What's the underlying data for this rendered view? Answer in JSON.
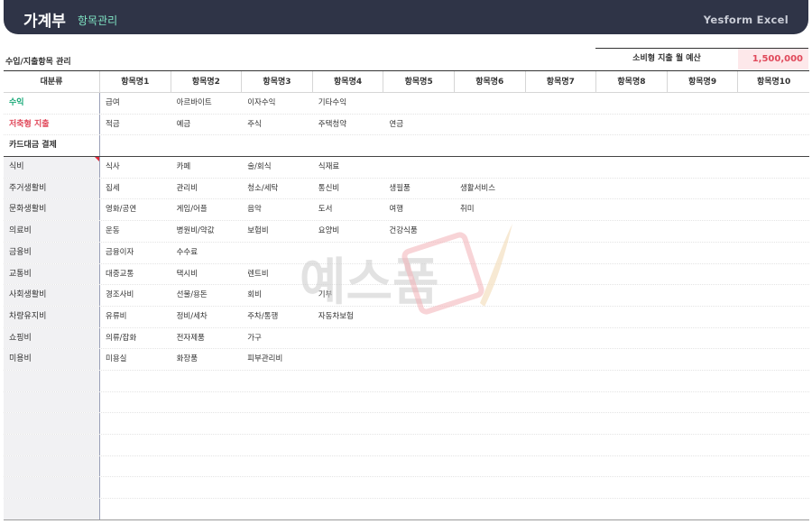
{
  "header": {
    "title": "가계부",
    "subtitle": "항목관리",
    "brand": "Yesform Excel"
  },
  "section_title": "수입/지출항목 관리",
  "budget": {
    "label": "소비형 지출 월 예산",
    "value": "1,500,000"
  },
  "watermark_text": "예스폼",
  "table": {
    "headers": [
      "대분류",
      "항목명1",
      "항목명2",
      "항목명3",
      "항목명4",
      "항목명5",
      "항목명6",
      "항목명7",
      "항목명8",
      "항목명9",
      "항목명10"
    ],
    "top_rows": [
      {
        "category": "수익",
        "color": "#1aa978",
        "items": [
          "급여",
          "아르바이트",
          "이자수익",
          "기타수익",
          "",
          "",
          "",
          "",
          "",
          ""
        ]
      },
      {
        "category": "저축형 지출",
        "color": "#e0485a",
        "items": [
          "적금",
          "예금",
          "주식",
          "주택청약",
          "연금",
          "",
          "",
          "",
          "",
          ""
        ]
      },
      {
        "category": "카드대금 결제",
        "color": "#333333",
        "items": [
          "",
          "",
          "",
          "",
          "",
          "",
          "",
          "",
          "",
          ""
        ]
      }
    ],
    "rows": [
      {
        "category": "식비",
        "items": [
          "식사",
          "카페",
          "술/회식",
          "식재료",
          "",
          "",
          "",
          "",
          "",
          ""
        ]
      },
      {
        "category": "주거생활비",
        "items": [
          "집세",
          "관리비",
          "청소/세탁",
          "통신비",
          "생필품",
          "생활서비스",
          "",
          "",
          "",
          ""
        ]
      },
      {
        "category": "문화생활비",
        "items": [
          "영화/공연",
          "게임/어플",
          "음악",
          "도서",
          "여행",
          "취미",
          "",
          "",
          "",
          ""
        ]
      },
      {
        "category": "의료비",
        "items": [
          "운동",
          "병원비/약값",
          "보험비",
          "요양비",
          "건강식품",
          "",
          "",
          "",
          "",
          ""
        ]
      },
      {
        "category": "금융비",
        "items": [
          "금융이자",
          "수수료",
          "",
          "",
          "",
          "",
          "",
          "",
          "",
          ""
        ]
      },
      {
        "category": "교통비",
        "items": [
          "대중교통",
          "택시비",
          "렌트비",
          "",
          "",
          "",
          "",
          "",
          "",
          ""
        ]
      },
      {
        "category": "사회생활비",
        "items": [
          "경조사비",
          "선물/용돈",
          "회비",
          "기부",
          "",
          "",
          "",
          "",
          "",
          ""
        ]
      },
      {
        "category": "차량유지비",
        "items": [
          "유류비",
          "정비/세차",
          "주차/통행",
          "자동차보험",
          "",
          "",
          "",
          "",
          "",
          ""
        ]
      },
      {
        "category": "쇼핑비",
        "items": [
          "의류/잡화",
          "전자제품",
          "가구",
          "",
          "",
          "",
          "",
          "",
          "",
          ""
        ]
      },
      {
        "category": "미용비",
        "items": [
          "미용실",
          "화장품",
          "피부관리비",
          "",
          "",
          "",
          "",
          "",
          "",
          ""
        ]
      }
    ],
    "empty_rows": 7
  }
}
